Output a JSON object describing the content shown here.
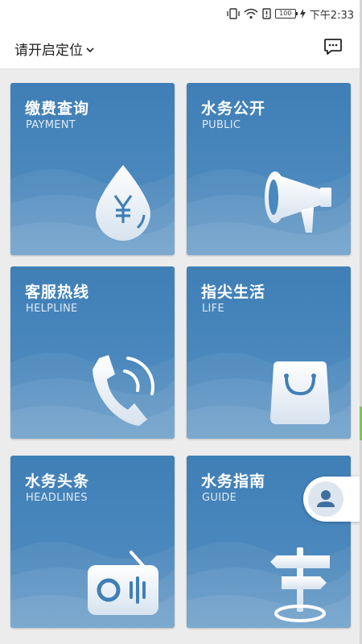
{
  "status_bar": {
    "battery": "100",
    "time": "下午2:33"
  },
  "header": {
    "location_label": "请开启定位",
    "message_icon": "message-bubble-icon"
  },
  "tiles": [
    {
      "title": "缴费查询",
      "subtitle": "PAYMENT",
      "icon": "yen-drop-icon"
    },
    {
      "title": "水务公开",
      "subtitle": "PUBLIC",
      "icon": "megaphone-icon"
    },
    {
      "title": "客服热线",
      "subtitle": "HELPLINE",
      "icon": "phone-icon"
    },
    {
      "title": "指尖生活",
      "subtitle": "LIFE",
      "icon": "shopping-bag-icon"
    },
    {
      "title": "水务头条",
      "subtitle": "HEADLINES",
      "icon": "radio-icon"
    },
    {
      "title": "水务指南",
      "subtitle": "GUIDE",
      "icon": "signpost-icon"
    }
  ],
  "colors": {
    "tile_top": "#3f7fb6",
    "tile_bottom": "#5f95c3",
    "header_bg": "#ffffff",
    "page_bg": "#ececec"
  }
}
